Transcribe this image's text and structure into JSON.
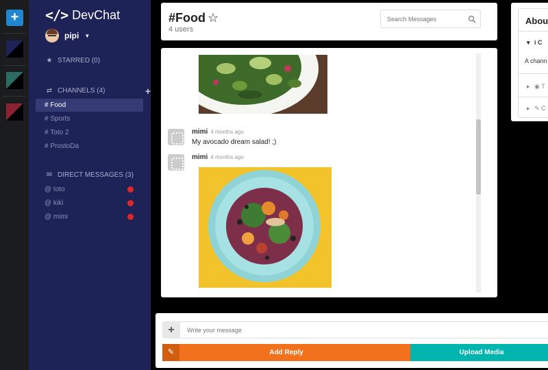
{
  "app": {
    "name": "DevChat",
    "logo_glyph": "</>"
  },
  "user": {
    "name": "pipi"
  },
  "sidebar": {
    "starred": {
      "label": "STARRED (0)"
    },
    "channels": {
      "label": "CHANNELS (4)",
      "items": [
        {
          "label": "# Food",
          "active": true
        },
        {
          "label": "# Sports"
        },
        {
          "label": "# Toto 2"
        },
        {
          "label": "# ProstoDa"
        }
      ]
    },
    "direct": {
      "label": "DIRECT MESSAGES (3)",
      "items": [
        {
          "label": "@ toto",
          "status_color": "#db2828"
        },
        {
          "label": "@ kiki",
          "status_color": "#db2828"
        },
        {
          "label": "@ mimi",
          "status_color": "#db2828"
        }
      ]
    }
  },
  "teams": [
    {
      "colors": [
        "#1d2257",
        "#000000"
      ]
    },
    {
      "colors": [
        "#2a6b62",
        "#000000"
      ]
    },
    {
      "colors": [
        "#8a2232",
        "#000000"
      ]
    }
  ],
  "channel": {
    "title": "#Food",
    "users": "4 users",
    "search_placeholder": "Search Messages"
  },
  "messages": [
    {
      "author": "mimi",
      "time": "4 months ago",
      "text": "My avocado dream salad! ;)"
    },
    {
      "author": "mimi",
      "time": "4 months ago",
      "image": "salad-plate"
    }
  ],
  "composer": {
    "placeholder": "Write your message",
    "reply_label": "Add Reply",
    "upload_label": "Upload Media"
  },
  "about": {
    "title": "About",
    "row1": "i C",
    "desc": "A chann",
    "row2": "T",
    "row3": "C"
  },
  "colors": {
    "primary_blue": "#2185d0",
    "sidebar": "#1d2257",
    "reply_orange": "#f2711c",
    "upload_teal": "#00b5ad"
  }
}
